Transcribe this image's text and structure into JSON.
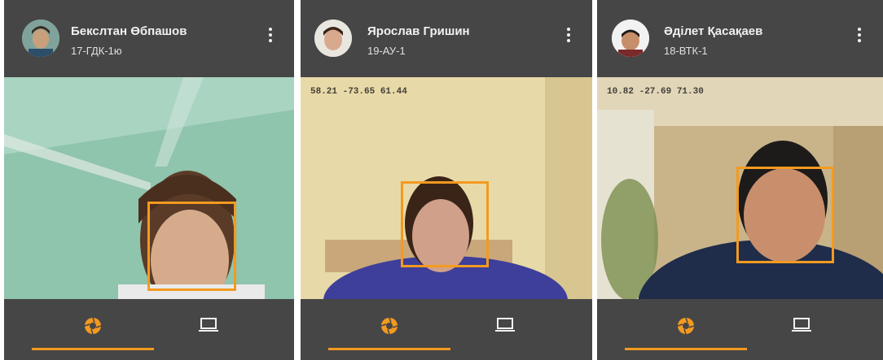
{
  "colors": {
    "accent": "#f39a20",
    "card_bg": "#464646",
    "text": "#f0f0f0"
  },
  "participants": [
    {
      "name": "Бекслтан Өбпашов",
      "group": "17-ГДК-1ю",
      "readout": "",
      "active_tab": "camera",
      "tabs": [
        {
          "icon": "camera-aperture-icon",
          "active": true
        },
        {
          "icon": "laptop-icon",
          "active": false
        }
      ]
    },
    {
      "name": "Ярослав Гришин",
      "group": "19-АУ-1",
      "readout": "58.21 -73.65 61.44",
      "active_tab": "camera",
      "tabs": [
        {
          "icon": "camera-aperture-icon",
          "active": true
        },
        {
          "icon": "laptop-icon",
          "active": false
        }
      ]
    },
    {
      "name": "Әділет Қасақаев",
      "group": "18-ВТК-1",
      "readout": "10.82 -27.69 71.30",
      "active_tab": "camera",
      "tabs": [
        {
          "icon": "camera-aperture-icon",
          "active": true
        },
        {
          "icon": "laptop-icon",
          "active": false
        }
      ]
    }
  ]
}
